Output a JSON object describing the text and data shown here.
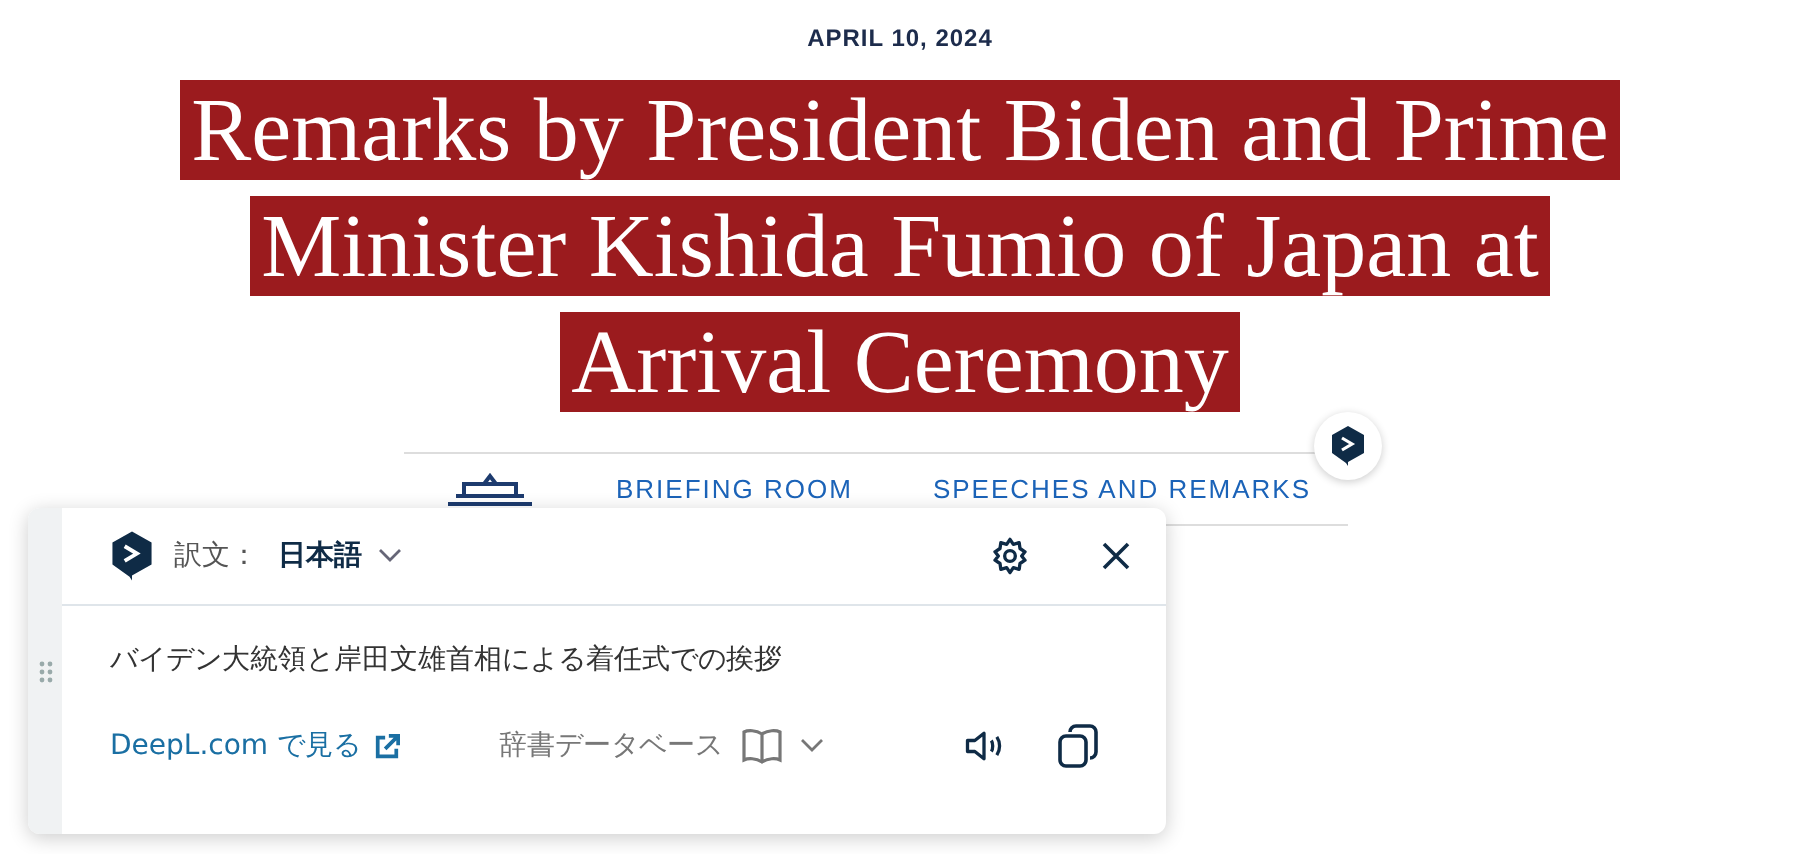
{
  "article": {
    "date": "APRIL 10, 2024",
    "title_lines": [
      "Remarks by President Biden and Prime",
      "Minister Kishida Fumio of Japan at",
      "Arrival Ceremony"
    ],
    "breadcrumbs": [
      "BRIEFING ROOM",
      "SPEECHES AND REMARKS"
    ]
  },
  "translator": {
    "label": "訳文：",
    "language": "日本語",
    "translation": "バイデン大統領と岸田文雄首相による着任式での挨拶",
    "link": "DeepL.com で見る",
    "dictionary": "辞書データベース"
  }
}
